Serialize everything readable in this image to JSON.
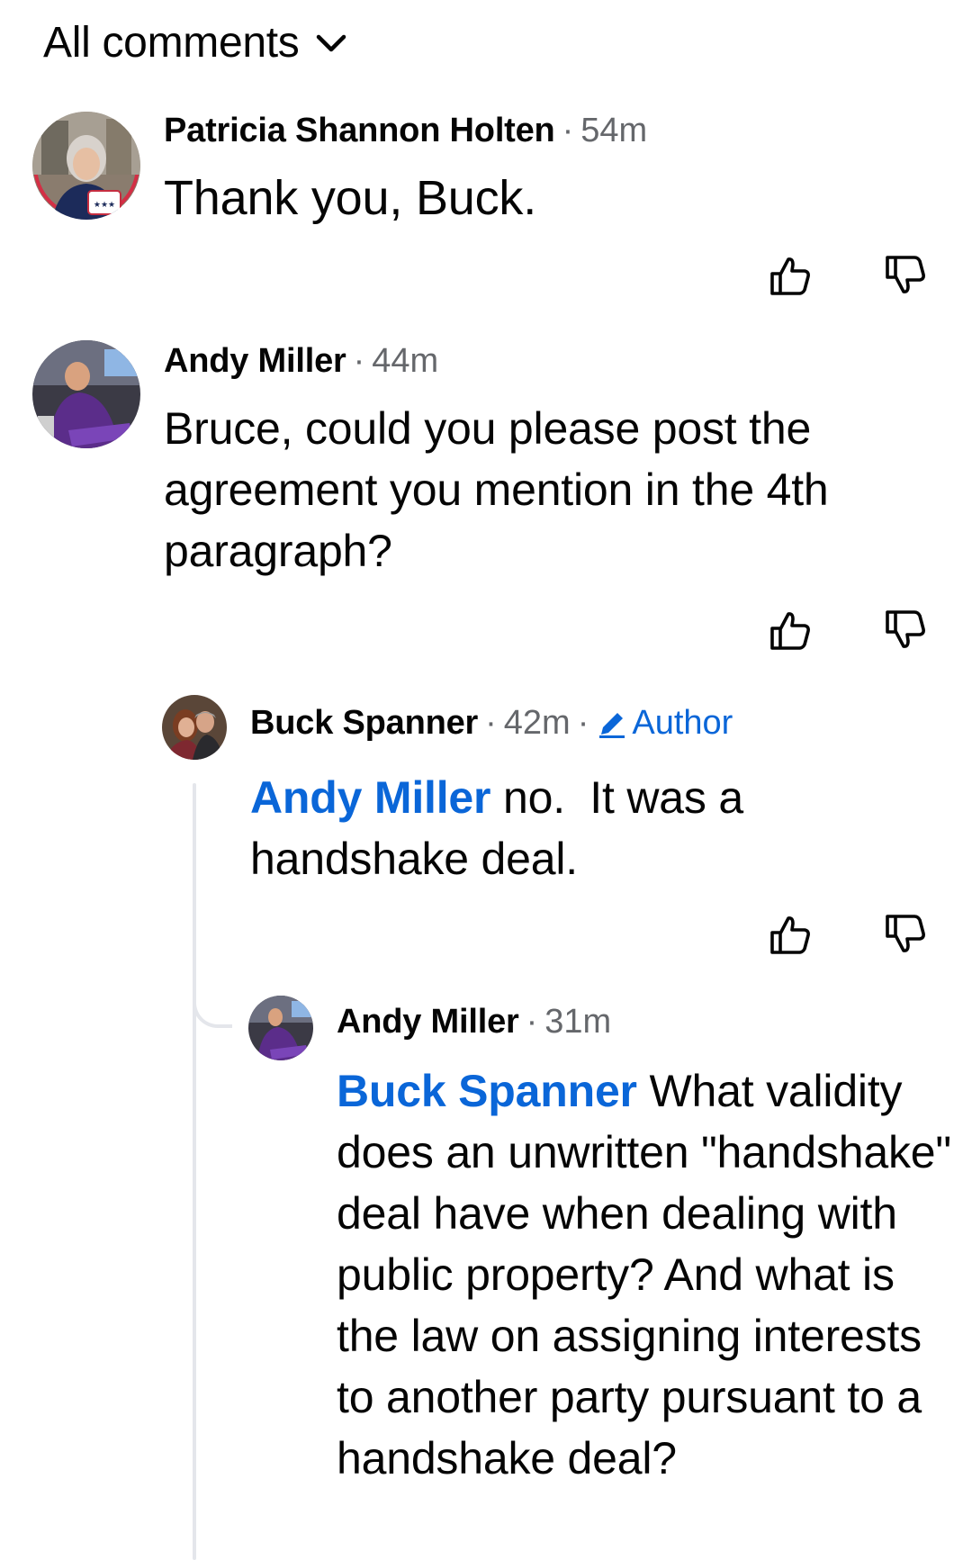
{
  "header": {
    "label": "All comments"
  },
  "comments": [
    {
      "name": "Patricia Shannon Holten",
      "separator": "·",
      "time": "54m",
      "text": "Thank you, Buck."
    },
    {
      "name": "Andy Miller",
      "separator": "·",
      "time": "44m",
      "text": "Bruce, could you please post the agreement you mention in the 4th paragraph?"
    },
    {
      "name": "Buck Spanner",
      "separator": "·",
      "time": "42m",
      "badge_separator": "·",
      "badge": "Author",
      "mention": "Andy Miller",
      "text": " no.  It was a handshake deal."
    },
    {
      "name": "Andy Miller",
      "separator": "·",
      "time": "31m",
      "mention": "Buck Spanner",
      "text": " What validity does an unwritten \"handshake\" deal have when dealing with public property? And what is the law on assigning interests to another party pursuant to a handshake deal?"
    }
  ],
  "colors": {
    "mention": "#0a66d8",
    "secondary_text": "#65676b",
    "thread_line": "#e4e6eb"
  },
  "icons": {
    "sort": "chevron-down-icon",
    "upvote": "thumbs-up-icon",
    "downvote": "thumbs-down-icon",
    "author": "pencil-icon"
  }
}
